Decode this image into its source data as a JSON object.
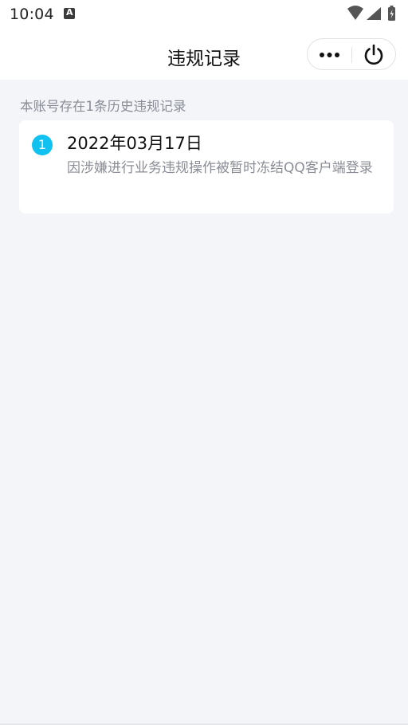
{
  "status_bar": {
    "time": "10:04",
    "icons": [
      "notification-a-icon",
      "wifi-icon",
      "cellular-signal-icon",
      "battery-charging-icon"
    ]
  },
  "nav": {
    "title": "违规记录",
    "capsule_icons": [
      "more-icon",
      "power-icon"
    ]
  },
  "summary": "本账号存在1条历史违规记录",
  "records": [
    {
      "index": "1",
      "date": "2022年03月17日",
      "description": "因涉嫌进行业务违规操作被暂时冻结QQ客户端登录"
    }
  ],
  "colors": {
    "background": "#f4f5f9",
    "accent": "#11c1ef",
    "secondary_text": "#8a8d96"
  }
}
